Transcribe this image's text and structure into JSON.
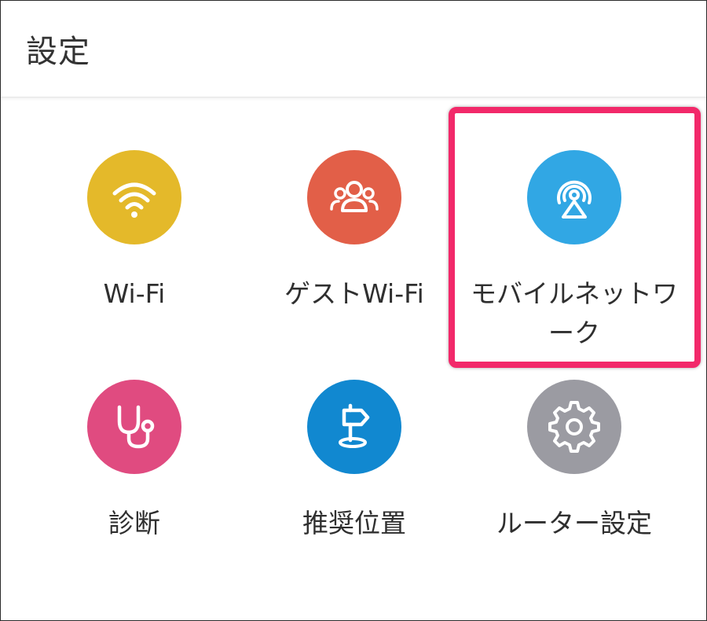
{
  "header": {
    "title": "設定"
  },
  "tiles": [
    {
      "label": "Wi-Fi",
      "icon": "wifi-icon",
      "color": "#e4b92a"
    },
    {
      "label": "ゲストWi-Fi",
      "icon": "guest-users-icon",
      "color": "#e25f48"
    },
    {
      "label": "モバイルネットワーク",
      "icon": "mobile-network-antenna-icon",
      "color": "#31a7e4"
    },
    {
      "label": "診断",
      "icon": "stethoscope-icon",
      "color": "#e04b80"
    },
    {
      "label": "推奨位置",
      "icon": "signpost-icon",
      "color": "#1188d0"
    },
    {
      "label": "ルーター設定",
      "icon": "gear-icon",
      "color": "#9b9ba2"
    }
  ],
  "highlight": {
    "target": "モバイルネットワーク",
    "color": "#f2296a"
  }
}
